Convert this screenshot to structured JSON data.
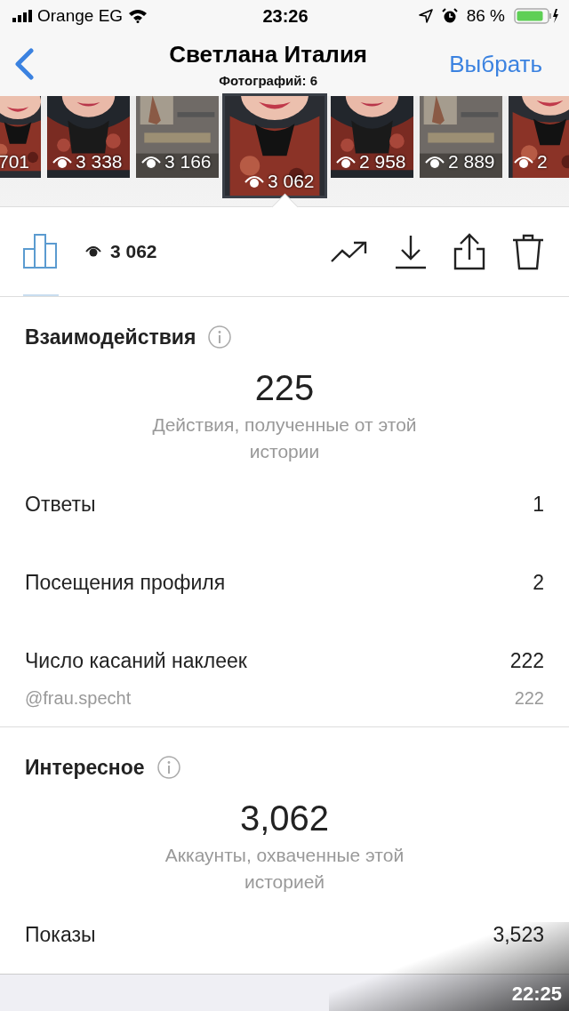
{
  "status_bar": {
    "carrier": "Orange EG",
    "time": "23:26",
    "battery": "86 %"
  },
  "nav": {
    "title": "Светлана Италия",
    "subtitle": "Фотографий: 6",
    "action": "Выбрать"
  },
  "stories": [
    {
      "views": "701",
      "eye_icon": false,
      "selected": false
    },
    {
      "views": "3 338",
      "eye_icon": true,
      "selected": false
    },
    {
      "views": "3 166",
      "eye_icon": true,
      "selected": false
    },
    {
      "views": "3 062",
      "eye_icon": true,
      "selected": true
    },
    {
      "views": "2 958",
      "eye_icon": true,
      "selected": false
    },
    {
      "views": "2 889",
      "eye_icon": true,
      "selected": false
    },
    {
      "views": "2",
      "eye_icon": true,
      "selected": false
    }
  ],
  "toolbar": {
    "views": "3 062",
    "tabs": [
      {
        "kind": "insights",
        "selected": true
      }
    ]
  },
  "sections": [
    {
      "title": "Взаимодействия",
      "total": "225",
      "caption": "Действия, полученные от этой истории",
      "rows": [
        {
          "label": "Ответы",
          "value": "1",
          "kind": "main"
        },
        {
          "label": "Посещения профиля",
          "value": "2",
          "kind": "main"
        },
        {
          "label": "Число касаний наклеек",
          "value": "222",
          "kind": "main"
        },
        {
          "label": "@frau.specht",
          "value": "222",
          "kind": "sub"
        }
      ]
    },
    {
      "title": "Интересное",
      "total": "3,062",
      "caption": "Аккаунты, охваченные этой историей",
      "rows": [
        {
          "label": "Показы",
          "value": "3,523",
          "kind": "main"
        }
      ]
    }
  ],
  "overlay_time": "22:25"
}
